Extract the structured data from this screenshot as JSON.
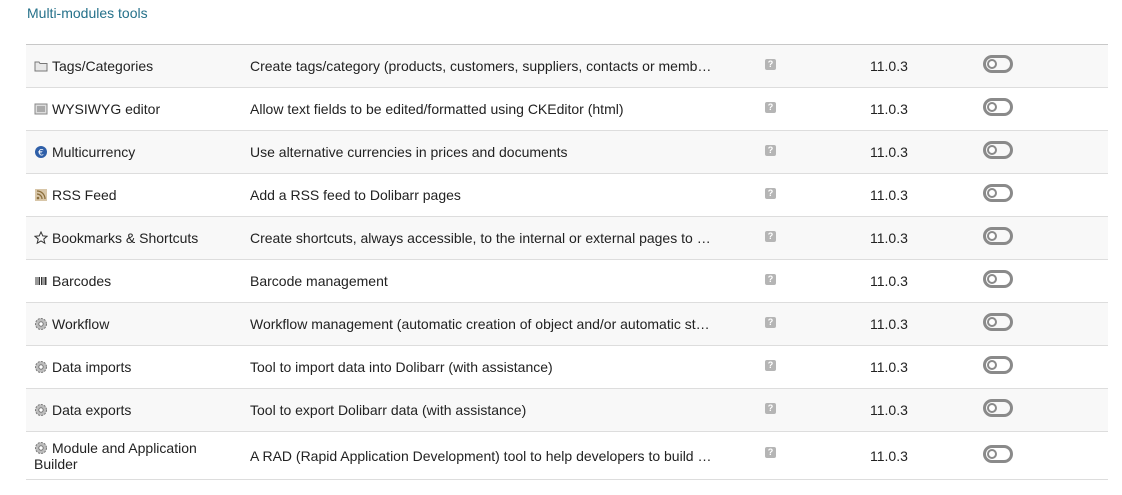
{
  "section": {
    "title": "Multi-modules tools"
  },
  "modules": [
    {
      "name": "Tags/Categories",
      "description": "Create tags/category (products, customers, suppliers, contacts or members)",
      "help": "?",
      "version": "11.0.3",
      "icon": "folder-icon"
    },
    {
      "name": "WYSIWYG editor",
      "description": "Allow text fields to be edited/formatted using CKEditor (html)",
      "help": "?",
      "version": "11.0.3",
      "icon": "editor-icon"
    },
    {
      "name": "Multicurrency",
      "description": "Use alternative currencies in prices and documents",
      "help": "?",
      "version": "11.0.3",
      "icon": "currency-icon"
    },
    {
      "name": "RSS Feed",
      "description": "Add a RSS feed to Dolibarr pages",
      "help": "?",
      "version": "11.0.3",
      "icon": "rss-icon"
    },
    {
      "name": "Bookmarks & Shortcuts",
      "description": "Create shortcuts, always accessible, to the internal or external pages to w…",
      "help": "?",
      "version": "11.0.3",
      "icon": "star-icon"
    },
    {
      "name": "Barcodes",
      "description": "Barcode management",
      "help": "?",
      "version": "11.0.3",
      "icon": "barcode-icon"
    },
    {
      "name": "Workflow",
      "description": "Workflow management (automatic creation of object and/or automatic stat…",
      "help": "?",
      "version": "11.0.3",
      "icon": "gear-icon"
    },
    {
      "name": "Data imports",
      "description": "Tool to import data into Dolibarr (with assistance)",
      "help": "?",
      "version": "11.0.3",
      "icon": "gear-icon"
    },
    {
      "name": "Data exports",
      "description": "Tool to export Dolibarr data (with assistance)",
      "help": "?",
      "version": "11.0.3",
      "icon": "gear-icon"
    },
    {
      "name": "Module and Application Builder",
      "description": "A RAD (Rapid Application Development) tool to help developers to build t…",
      "help": "?",
      "version": "11.0.3",
      "icon": "gear-icon"
    }
  ]
}
